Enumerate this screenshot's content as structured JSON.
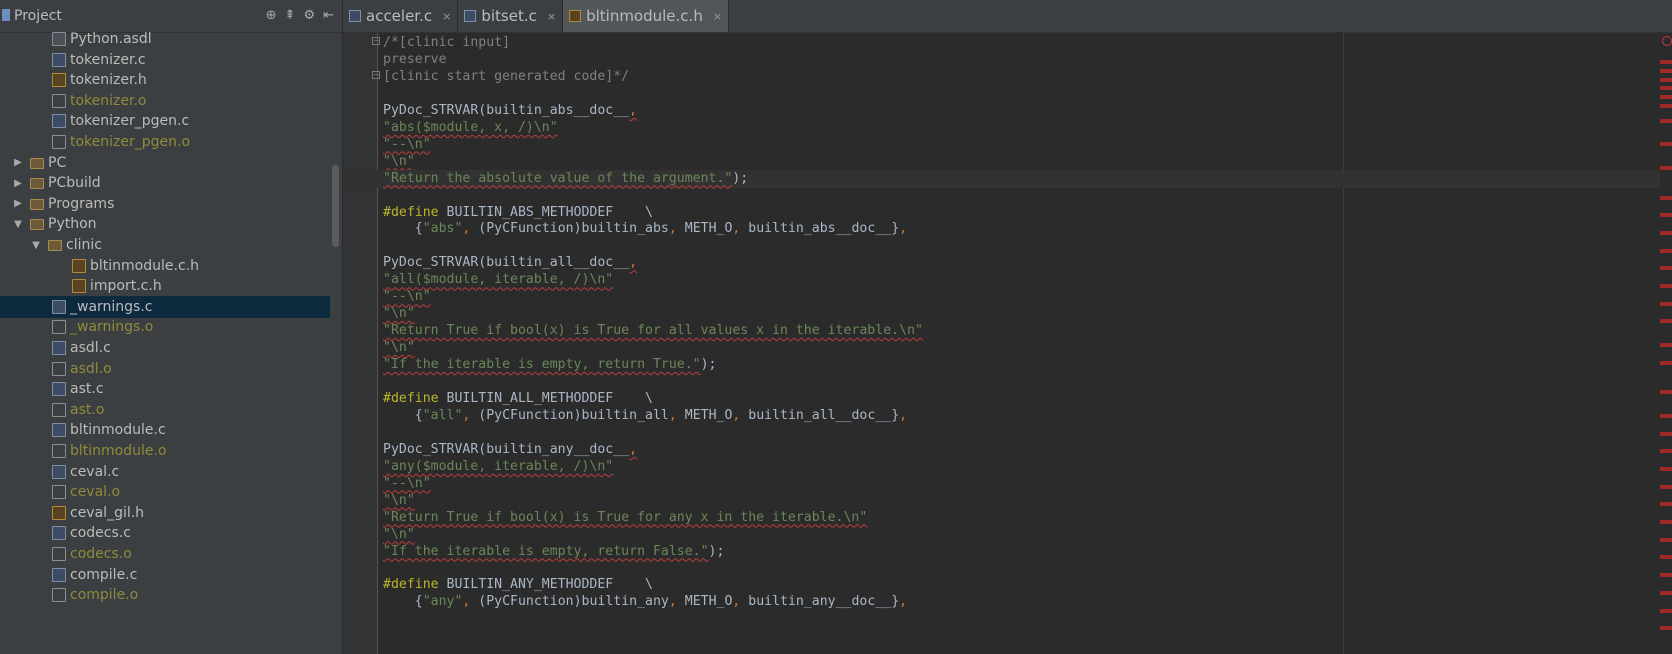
{
  "project": {
    "title": "Project",
    "header_icons": [
      "target-icon",
      "collapse-icon",
      "gear-icon",
      "hide-icon"
    ],
    "tree": [
      {
        "label": "Python.asdl",
        "icon": "file",
        "indent": 3,
        "obj": false
      },
      {
        "label": "tokenizer.c",
        "icon": "c",
        "indent": 3,
        "obj": false
      },
      {
        "label": "tokenizer.h",
        "icon": "h",
        "indent": 3,
        "obj": false
      },
      {
        "label": "tokenizer.o",
        "icon": "o",
        "indent": 3,
        "obj": true
      },
      {
        "label": "tokenizer_pgen.c",
        "icon": "c",
        "indent": 3,
        "obj": false
      },
      {
        "label": "tokenizer_pgen.o",
        "icon": "o",
        "indent": 3,
        "obj": true
      },
      {
        "label": "PC",
        "icon": "folder",
        "indent": 1,
        "arrow": "▶",
        "obj": false
      },
      {
        "label": "PCbuild",
        "icon": "folder",
        "indent": 1,
        "arrow": "▶",
        "obj": false
      },
      {
        "label": "Programs",
        "icon": "folder",
        "indent": 1,
        "arrow": "▶",
        "obj": false
      },
      {
        "label": "Python",
        "icon": "folder",
        "indent": 1,
        "arrow": "▼",
        "obj": false
      },
      {
        "label": "clinic",
        "icon": "folder",
        "indent": 2,
        "arrow": "▼",
        "obj": false
      },
      {
        "label": "bltinmodule.c.h",
        "icon": "h",
        "indent": 4,
        "obj": false
      },
      {
        "label": "import.c.h",
        "icon": "h",
        "indent": 4,
        "obj": false
      },
      {
        "label": "_warnings.c",
        "icon": "c",
        "indent": 3,
        "obj": false,
        "selected": true
      },
      {
        "label": "_warnings.o",
        "icon": "o",
        "indent": 3,
        "obj": true
      },
      {
        "label": "asdl.c",
        "icon": "c",
        "indent": 3,
        "obj": false
      },
      {
        "label": "asdl.o",
        "icon": "o",
        "indent": 3,
        "obj": true
      },
      {
        "label": "ast.c",
        "icon": "c",
        "indent": 3,
        "obj": false
      },
      {
        "label": "ast.o",
        "icon": "o",
        "indent": 3,
        "obj": true
      },
      {
        "label": "bltinmodule.c",
        "icon": "c",
        "indent": 3,
        "obj": false
      },
      {
        "label": "bltinmodule.o",
        "icon": "o",
        "indent": 3,
        "obj": true
      },
      {
        "label": "ceval.c",
        "icon": "c",
        "indent": 3,
        "obj": false
      },
      {
        "label": "ceval.o",
        "icon": "o",
        "indent": 3,
        "obj": true
      },
      {
        "label": "ceval_gil.h",
        "icon": "h",
        "indent": 3,
        "obj": false
      },
      {
        "label": "codecs.c",
        "icon": "c",
        "indent": 3,
        "obj": false
      },
      {
        "label": "codecs.o",
        "icon": "o",
        "indent": 3,
        "obj": true
      },
      {
        "label": "compile.c",
        "icon": "c",
        "indent": 3,
        "obj": false
      },
      {
        "label": "compile.o",
        "icon": "o",
        "indent": 3,
        "obj": true
      }
    ]
  },
  "tabs": [
    {
      "label": "acceler.c",
      "icon": "c",
      "active": false
    },
    {
      "label": "bitset.c",
      "icon": "c",
      "active": false
    },
    {
      "label": "bltinmodule.c.h",
      "icon": "h",
      "active": true
    }
  ],
  "tab_close_glyph": "×",
  "editor": {
    "current_line": 8,
    "lines": [
      [
        [
          "cm",
          "/*[clinic input]"
        ]
      ],
      [
        [
          "cm",
          "preserve"
        ]
      ],
      [
        [
          "cm",
          "[clinic start generated code]*/"
        ]
      ],
      [],
      [
        [
          "t",
          "PyDoc_STRVAR(builtin_abs__doc__"
        ],
        [
          "und",
          ","
        ]
      ],
      [
        [
          "str",
          "\"abs($module, x, /)\\n\""
        ]
      ],
      [
        [
          "str",
          "\"--\\n\""
        ]
      ],
      [
        [
          "str",
          "\"\\n\""
        ]
      ],
      [
        [
          "str",
          "\"Return the absolute value of the argument.\""
        ],
        [
          "t",
          ");"
        ]
      ],
      [],
      [
        [
          "pp",
          "#define"
        ],
        [
          "t",
          " BUILTIN_ABS_METHODDEF    \\"
        ]
      ],
      [
        [
          "t",
          "    {"
        ],
        [
          "str2",
          "\"abs\""
        ],
        [
          "punct",
          ", "
        ],
        [
          "t",
          "(PyCFunction)builtin_abs"
        ],
        [
          "punct",
          ", "
        ],
        [
          "t",
          "METH_O"
        ],
        [
          "punct",
          ", "
        ],
        [
          "t",
          "builtin_abs__doc__}"
        ],
        [
          "punct",
          ","
        ]
      ],
      [],
      [
        [
          "t",
          "PyDoc_STRVAR(builtin_all__doc__"
        ],
        [
          "und",
          ","
        ]
      ],
      [
        [
          "str",
          "\"all($module, iterable, /)\\n\""
        ]
      ],
      [
        [
          "str",
          "\"--\\n\""
        ]
      ],
      [
        [
          "str",
          "\"\\n\""
        ]
      ],
      [
        [
          "str",
          "\"Return True if bool(x) is True for all values x in the iterable.\\n\""
        ]
      ],
      [
        [
          "str",
          "\"\\n\""
        ]
      ],
      [
        [
          "str",
          "\"If the iterable is empty, return True.\""
        ],
        [
          "t",
          ");"
        ]
      ],
      [],
      [
        [
          "pp",
          "#define"
        ],
        [
          "t",
          " BUILTIN_ALL_METHODDEF    \\"
        ]
      ],
      [
        [
          "t",
          "    {"
        ],
        [
          "str2",
          "\"all\""
        ],
        [
          "punct",
          ", "
        ],
        [
          "t",
          "(PyCFunction)builtin_all"
        ],
        [
          "punct",
          ", "
        ],
        [
          "t",
          "METH_O"
        ],
        [
          "punct",
          ", "
        ],
        [
          "t",
          "builtin_all__doc__}"
        ],
        [
          "punct",
          ","
        ]
      ],
      [],
      [
        [
          "t",
          "PyDoc_STRVAR(builtin_any__doc__"
        ],
        [
          "und",
          ","
        ]
      ],
      [
        [
          "str",
          "\"any($module, iterable, /)\\n\""
        ]
      ],
      [
        [
          "str",
          "\"--\\n\""
        ]
      ],
      [
        [
          "str",
          "\"\\n\""
        ]
      ],
      [
        [
          "str",
          "\"Return True if bool(x) is True for any x in the iterable.\\n\""
        ]
      ],
      [
        [
          "str",
          "\"\\n\""
        ]
      ],
      [
        [
          "str",
          "\"If the iterable is empty, return False.\""
        ],
        [
          "t",
          ");"
        ]
      ],
      [],
      [
        [
          "pp",
          "#define"
        ],
        [
          "t",
          " BUILTIN_ANY_METHODDEF    \\"
        ]
      ],
      [
        [
          "t",
          "    {"
        ],
        [
          "str2",
          "\"any\""
        ],
        [
          "punct",
          ", "
        ],
        [
          "t",
          "(PyCFunction)builtin_any"
        ],
        [
          "punct",
          ", "
        ],
        [
          "t",
          "METH_O"
        ],
        [
          "punct",
          ", "
        ],
        [
          "t",
          "builtin_any__doc__}"
        ],
        [
          "punct",
          ","
        ]
      ]
    ]
  },
  "error_marks": [
    0.02,
    0.035,
    0.05,
    0.065,
    0.08,
    0.095,
    0.12,
    0.16,
    0.2,
    0.25,
    0.28,
    0.31,
    0.34,
    0.37,
    0.4,
    0.43,
    0.46,
    0.5,
    0.53,
    0.58,
    0.62,
    0.65,
    0.68,
    0.71,
    0.74,
    0.77,
    0.8,
    0.83,
    0.86,
    0.89,
    0.92,
    0.95,
    0.98
  ],
  "colors": {
    "error": "#9e2927",
    "selection": "#0d293e"
  }
}
